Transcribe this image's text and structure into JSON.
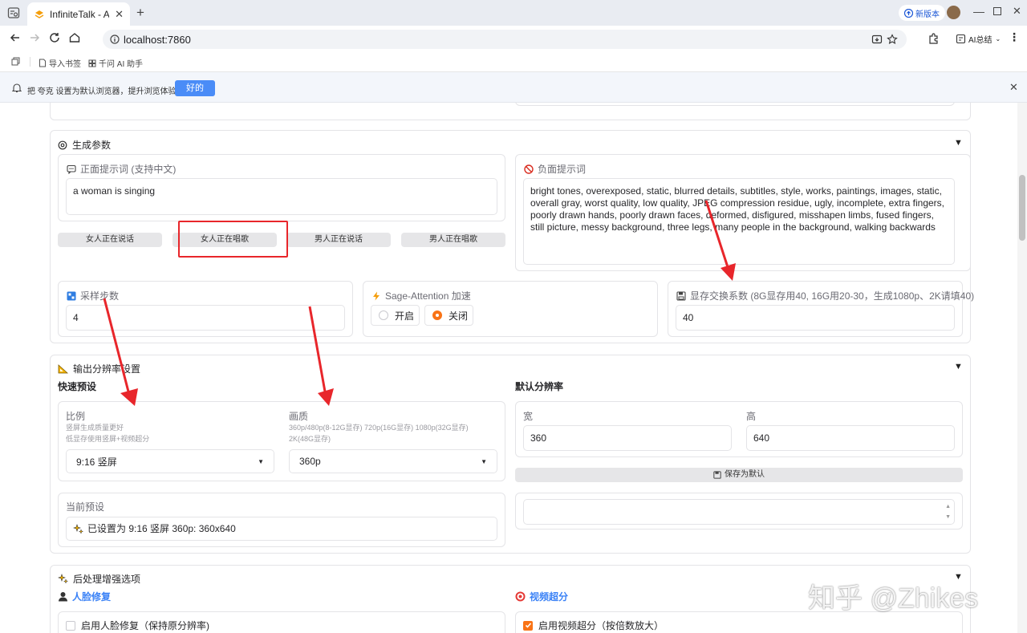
{
  "browser": {
    "tab_title": "InfiniteTalk - AI视",
    "url": "localhost:7860",
    "new_version_badge": "新版本",
    "ai_summary_label": "AI总结",
    "bookmarks": [
      "导入书签",
      "千问 AI 助手"
    ],
    "infobar": {
      "message": "把 夸克 设置为默认浏览器，提升浏览体验",
      "ok_label": "好的"
    }
  },
  "generation_params": {
    "title": "生成参数",
    "positive_prompt": {
      "label": "正面提示词 (支持中文)",
      "value": "a woman is singing"
    },
    "negative_prompt": {
      "label": "负面提示词",
      "value": "bright tones, overexposed, static, blurred details, subtitles, style, works, paintings, images, static, overall gray, worst quality, low quality, JPEG compression residue, ugly, incomplete, extra fingers, poorly drawn hands, poorly drawn faces, deformed, disfigured, misshapen limbs, fused fingers, still picture, messy background, three legs, many people in the background, walking backwards"
    },
    "preset_buttons": [
      "女人正在说话",
      "女人正在唱歌",
      "男人正在说话",
      "男人正在唱歌"
    ],
    "sampling_steps": {
      "label": "采样步数",
      "value": "4"
    },
    "sage_attention": {
      "label": "Sage-Attention 加速",
      "options": [
        "开启",
        "关闭"
      ],
      "selected": "关闭"
    },
    "vram_swap": {
      "label": "显存交换系数 (8G显存用40, 16G用20-30，生成1080p、2K请填40)",
      "value": "40"
    }
  },
  "resolution": {
    "title": "输出分辨率设置",
    "quick_preset_title": "快速预设",
    "ratio": {
      "label": "比例",
      "hints": [
        "竖屏生成质量更好",
        "低显存使用竖屏+视频超分"
      ],
      "value": "9:16 竖屏"
    },
    "quality": {
      "label": "画质",
      "hints": [
        "360p/480p(8-12G显存) 720p(16G显存) 1080p(32G显存)",
        "2K(48G显存)"
      ],
      "value": "360p"
    },
    "current_preset": {
      "label": "当前预设",
      "value": "已设置为 9:16 竖屏 360p: 360x640"
    },
    "default_title": "默认分辨率",
    "width": {
      "label": "宽",
      "value": "360"
    },
    "height": {
      "label": "高",
      "value": "640"
    },
    "save_default_label": "保存为默认"
  },
  "postprocess": {
    "title": "后处理增强选项",
    "face_restore": {
      "title": "人脸修复",
      "checkbox_label": "启用人脸修复（保持原分辨率)",
      "checked": false
    },
    "video_upscale": {
      "title": "视频超分",
      "checkbox_label": "启用视频超分（按倍数放大）",
      "checked": true
    }
  },
  "watermark": "知乎 @Zhikes",
  "colors": {
    "accent": "#f97316",
    "blue": "#3b82f6",
    "annotation_red": "#e8262b"
  }
}
